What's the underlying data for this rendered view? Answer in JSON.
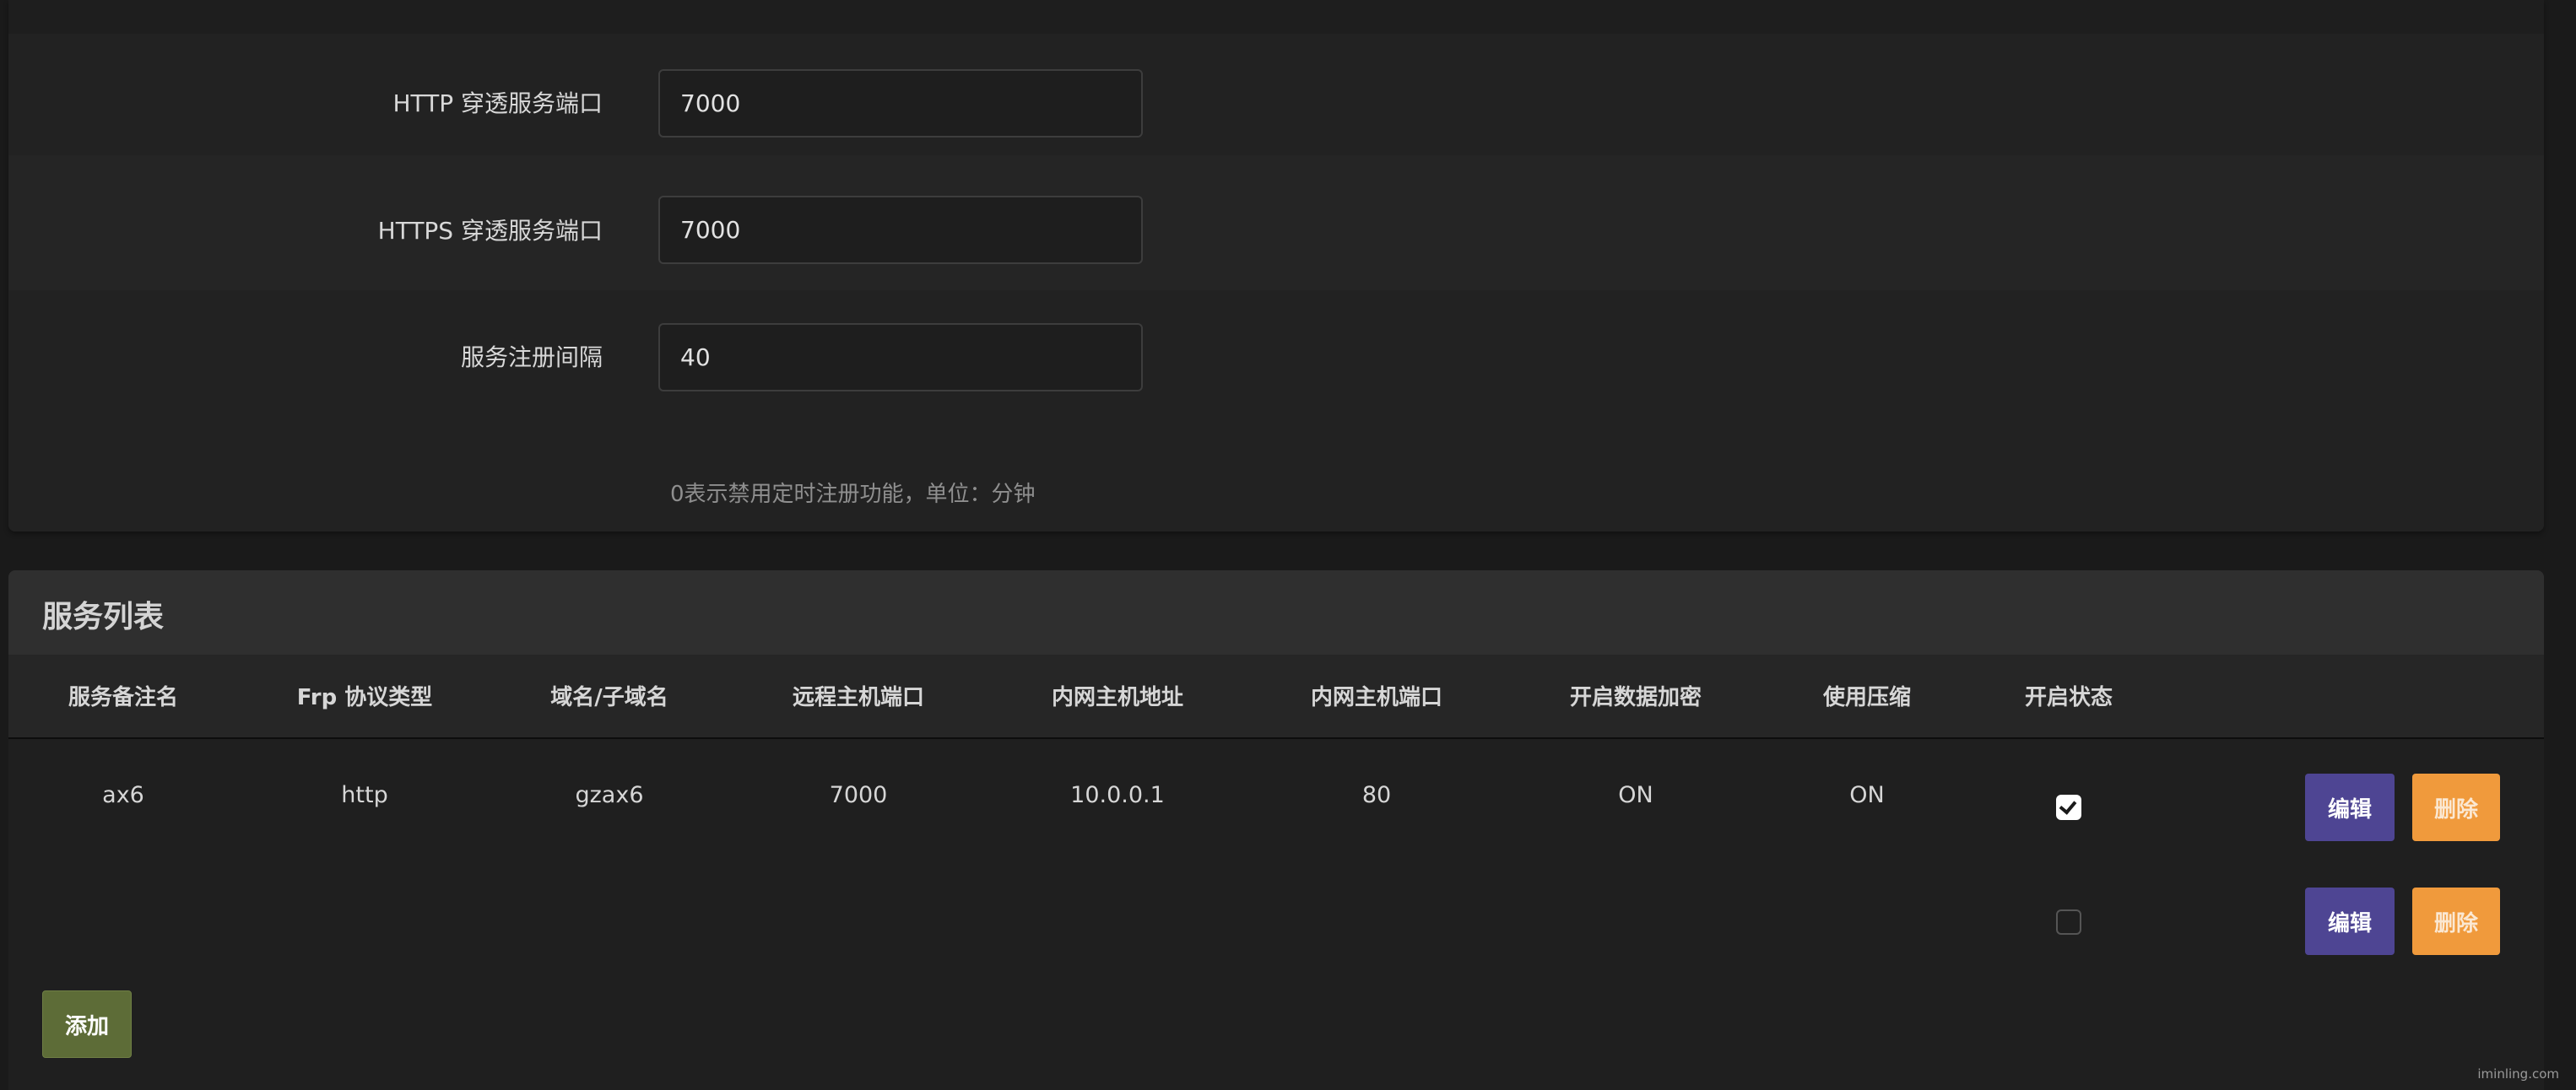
{
  "settings": {
    "http_port": {
      "label": "HTTP 穿透服务端口",
      "value": "7000"
    },
    "https_port": {
      "label": "HTTPS 穿透服务端口",
      "value": "7000"
    },
    "register_interval": {
      "label": "服务注册间隔",
      "value": "40",
      "help": "0表示禁用定时注册功能，单位：分钟"
    }
  },
  "service_list": {
    "title": "服务列表",
    "columns": [
      "服务备注名",
      "Frp 协议类型",
      "域名/子域名",
      "远程主机端口",
      "内网主机地址",
      "内网主机端口",
      "开启数据加密",
      "使用压缩",
      "开启状态"
    ],
    "rows": [
      {
        "name": "ax6",
        "protocol": "http",
        "domain": "gzax6",
        "remote_port": "7000",
        "local_addr": "10.0.0.1",
        "local_port": "80",
        "encryption": "ON",
        "compression": "ON",
        "enabled": true
      },
      {
        "name": "",
        "protocol": "",
        "domain": "",
        "remote_port": "",
        "local_addr": "",
        "local_port": "",
        "encryption": "",
        "compression": "",
        "enabled": false
      }
    ],
    "edit_label": "编辑",
    "delete_label": "删除",
    "add_label": "添加"
  },
  "watermark": "iminling.com"
}
